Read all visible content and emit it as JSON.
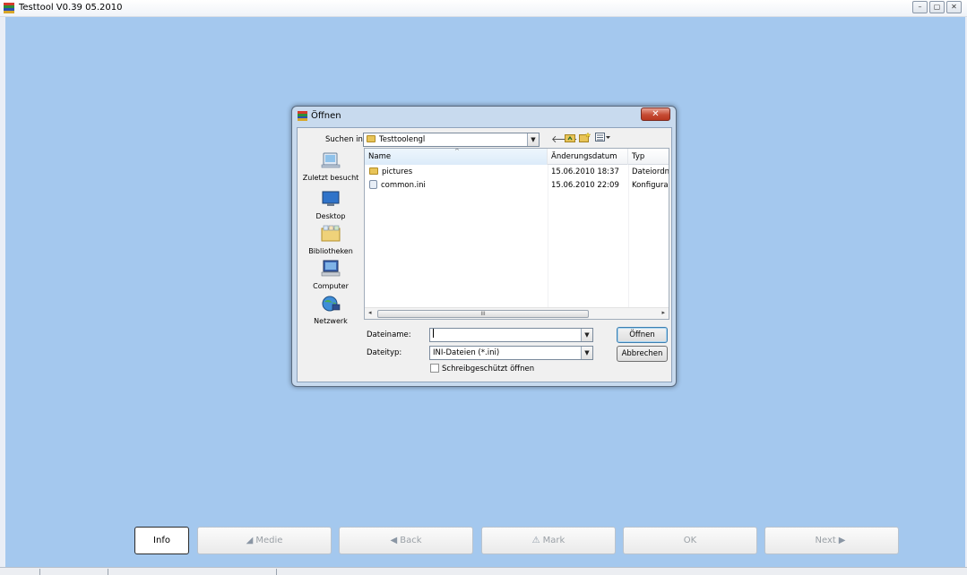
{
  "app": {
    "title": "Testtool V0.39 05.2010",
    "window_controls": [
      "–",
      "▢",
      "✕"
    ]
  },
  "dialog": {
    "title": "Öffnen",
    "close_label": "✕",
    "look_in_label": "Suchen in:",
    "look_in_value": "Testtoolengl",
    "places": [
      "Zuletzt besucht",
      "Desktop",
      "Bibliotheken",
      "Computer",
      "Netzwerk"
    ],
    "columns": [
      "Name",
      "Änderungsdatum",
      "Typ"
    ],
    "files": [
      {
        "name": "pictures",
        "date": "15.06.2010 18:37",
        "type": "Dateiordn",
        "icon": "folder-icon"
      },
      {
        "name": "common.ini",
        "date": "15.06.2010 22:09",
        "type": "Konfigura",
        "icon": "ini-file-icon"
      }
    ],
    "filename_label": "Dateiname:",
    "filename_value": "",
    "filetype_label": "Dateityp:",
    "filetype_value": "INI-Dateien (*.ini)",
    "open_button": "Öffnen",
    "cancel_button": "Abbrechen",
    "readonly_label": "Schreibgeschützt öffnen",
    "scroll_thumb": "III"
  },
  "bottom_buttons": {
    "info": "Info",
    "media": "Medie",
    "back": "Back",
    "mark": "Mark",
    "ok": "OK",
    "next": "Next"
  },
  "colors": {
    "client_bg": "#a4c8ee",
    "dialog_frame": "#c8daee",
    "close_red": "#c64b34"
  }
}
